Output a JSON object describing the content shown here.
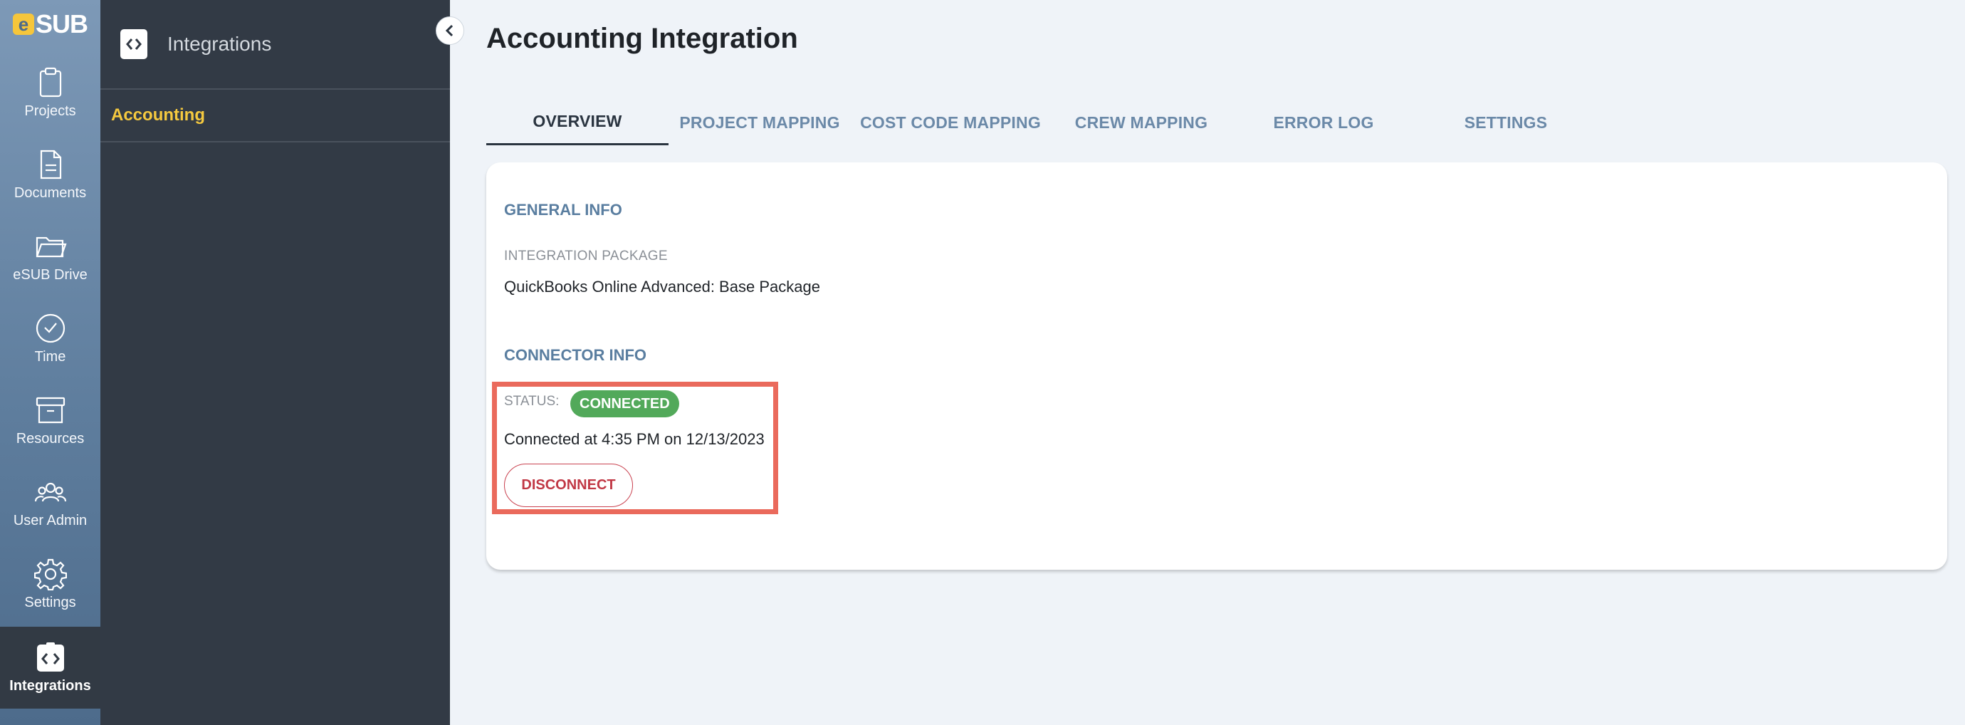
{
  "app": {
    "logo_e": "e",
    "logo_text": "SUB"
  },
  "appnav": [
    {
      "label": "Projects",
      "icon": "clipboard-icon"
    },
    {
      "label": "Documents",
      "icon": "document-icon"
    },
    {
      "label": "eSUB Drive",
      "icon": "folder-icon"
    },
    {
      "label": "Time",
      "icon": "clock-icon"
    },
    {
      "label": "Resources",
      "icon": "archive-box-icon"
    },
    {
      "label": "User Admin",
      "icon": "users-icon"
    },
    {
      "label": "Settings",
      "icon": "gear-icon"
    },
    {
      "label": "Integrations",
      "icon": "integrations-icon",
      "active": true
    }
  ],
  "sidebar": {
    "title": "Integrations",
    "items": [
      {
        "label": "Accounting",
        "active": true
      }
    ]
  },
  "main": {
    "title": "Accounting Integration",
    "tabs": [
      {
        "label": "OVERVIEW",
        "active": true
      },
      {
        "label": "PROJECT MAPPING"
      },
      {
        "label": "COST CODE MAPPING"
      },
      {
        "label": "CREW MAPPING"
      },
      {
        "label": "ERROR LOG"
      },
      {
        "label": "SETTINGS"
      }
    ],
    "general_info": {
      "title": "GENERAL INFO",
      "package_label": "INTEGRATION PACKAGE",
      "package_value": "QuickBooks Online Advanced: Base Package"
    },
    "connector_info": {
      "title": "CONNECTOR INFO",
      "status_label": "STATUS:",
      "status_value": "CONNECTED",
      "connected_at": "Connected at 4:35 PM on 12/13/2023",
      "disconnect_label": "DISCONNECT"
    }
  },
  "colors": {
    "accent": "#f5c93f",
    "status_connected": "#52a95a",
    "danger": "#c13845",
    "highlight": "#ea6a5c"
  }
}
